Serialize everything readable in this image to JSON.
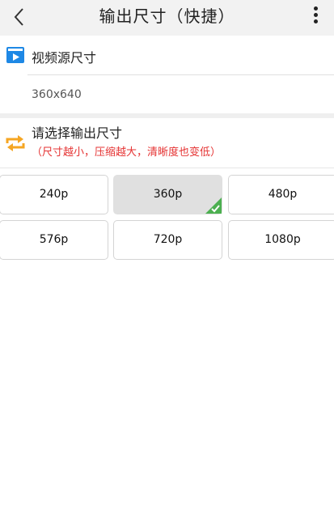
{
  "header": {
    "title": "输出尺寸（快捷）",
    "back_icon": "chevron-left-icon",
    "more_icon": "more-vertical-icon"
  },
  "source": {
    "label": "视频源尺寸",
    "value": "360x640",
    "icon": "video-play-icon",
    "icon_color": "#1e88e5"
  },
  "output": {
    "label": "请选择输出尺寸",
    "hint": "（尺寸越小，压缩越大，清晰度也变低）",
    "hint_color": "#e53333",
    "icon": "convert-icon",
    "icon_color": "#f5a623"
  },
  "sizes": [
    {
      "label": "240p",
      "selected": false
    },
    {
      "label": "360p",
      "selected": true
    },
    {
      "label": "480p",
      "selected": false
    },
    {
      "label": "576p",
      "selected": false
    },
    {
      "label": "720p",
      "selected": false
    },
    {
      "label": "1080p",
      "selected": false
    }
  ],
  "selected_check_color": "#4caf50"
}
